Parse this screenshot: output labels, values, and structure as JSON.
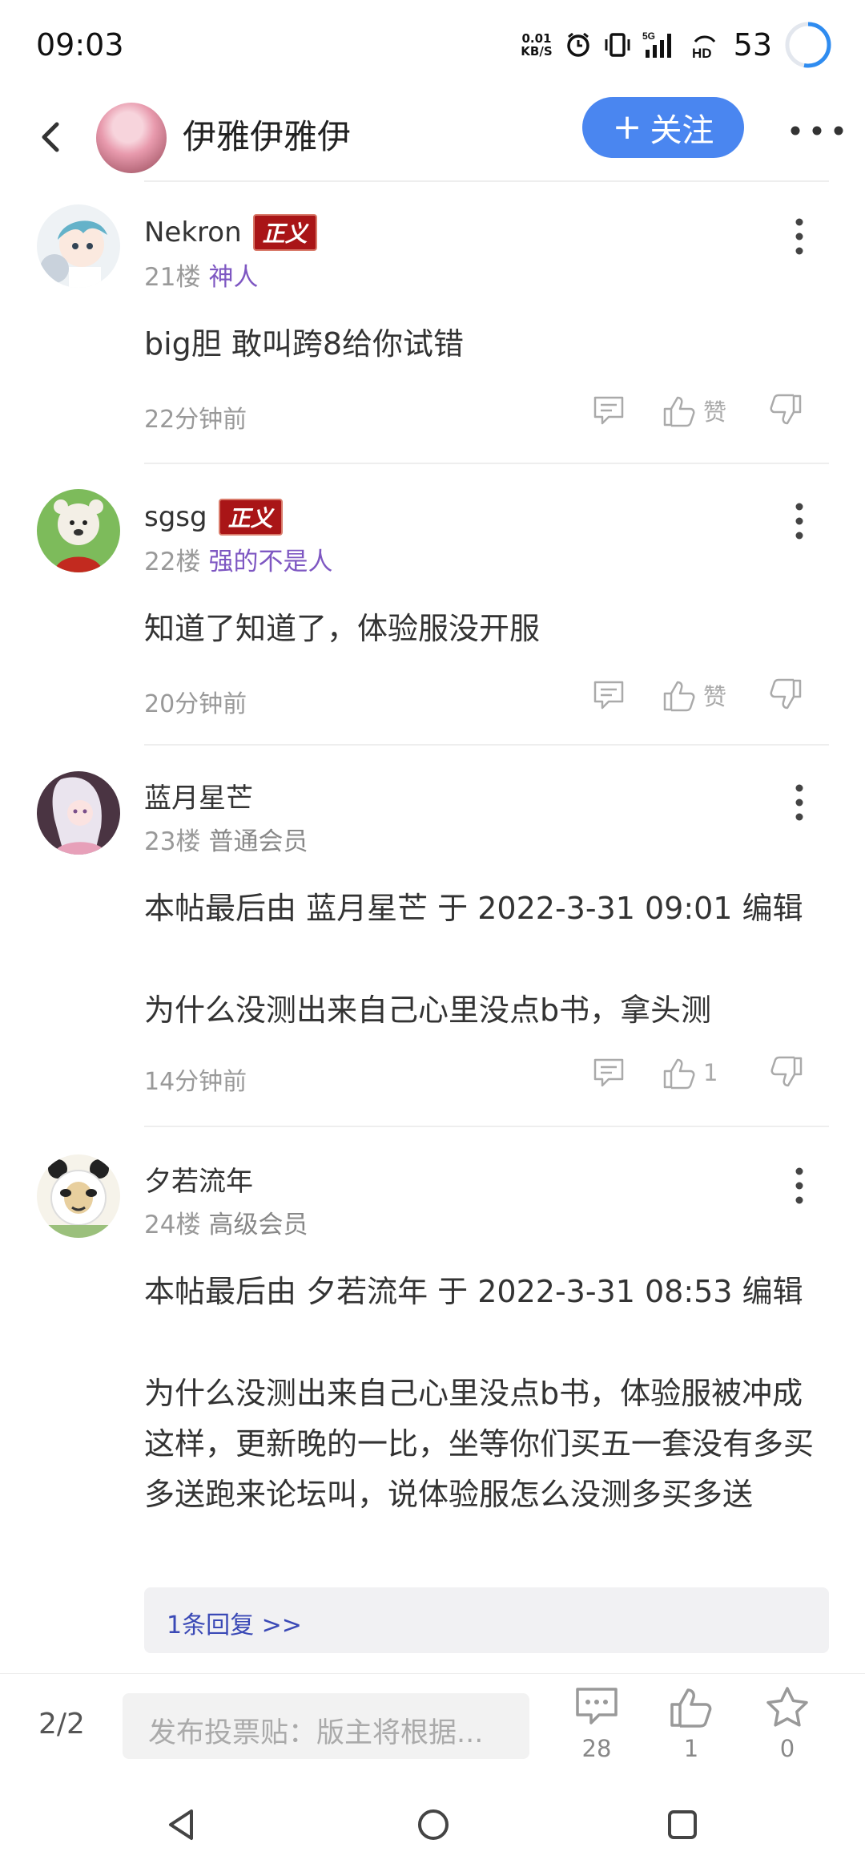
{
  "status_bar": {
    "time": "09:03",
    "net_speed_top": "0.01",
    "net_speed_bottom": "KB/S",
    "network": "5G",
    "hd": "HD",
    "battery": "53",
    "icons": [
      "alarm-icon",
      "vibrate-icon",
      "signal-icon",
      "hd-icon",
      "battery-ring-icon"
    ]
  },
  "header": {
    "title": "伊雅伊雅伊",
    "follow_label": "关注",
    "follow_plus": "+"
  },
  "posts": [
    {
      "username": "Nekron",
      "badge": "正义",
      "floor": "21楼",
      "rank": "神人",
      "content": "big胆 敢叫跨8给你试错",
      "time": "22分钟前",
      "like_text": "赞"
    },
    {
      "username": "sgsg",
      "badge": "正义",
      "floor": "22楼",
      "rank": "强的不是人",
      "content": "知道了知道了，体验服没开服",
      "time": "20分钟前",
      "like_text": "赞"
    },
    {
      "username": "蓝月星芒",
      "floor": "23楼",
      "rank": "普通会员",
      "content_line1": "本帖最后由 蓝月星芒 于 2022-3-31 09:01 编辑",
      "content_line2": "为什么没测出来自己心里没点b书，拿头测",
      "time": "14分钟前",
      "like_text": "1"
    },
    {
      "username": "夕若流年",
      "floor": "24楼",
      "rank": "高级会员",
      "content_line1": "本帖最后由 夕若流年 于 2022-3-31 08:53 编辑",
      "content_line2": "为什么没测出来自己心里没点b书，体验服被冲成这样，更新晚的一比，坐等你们买五一套没有多买多送跑来论坛叫，说体验服怎么没测多买多送",
      "reply_link": "1条回复 >>"
    }
  ],
  "bottom_bar": {
    "page": "2/2",
    "compose_placeholder": "发布投票贴：版主将根据...",
    "comment_count": "28",
    "like_count": "1",
    "star_count": "0"
  },
  "colors": {
    "accent": "#4a86f0",
    "badge_bg": "#a91517",
    "rank_purple": "#7e57c2",
    "reply_link": "#3a49b6"
  }
}
